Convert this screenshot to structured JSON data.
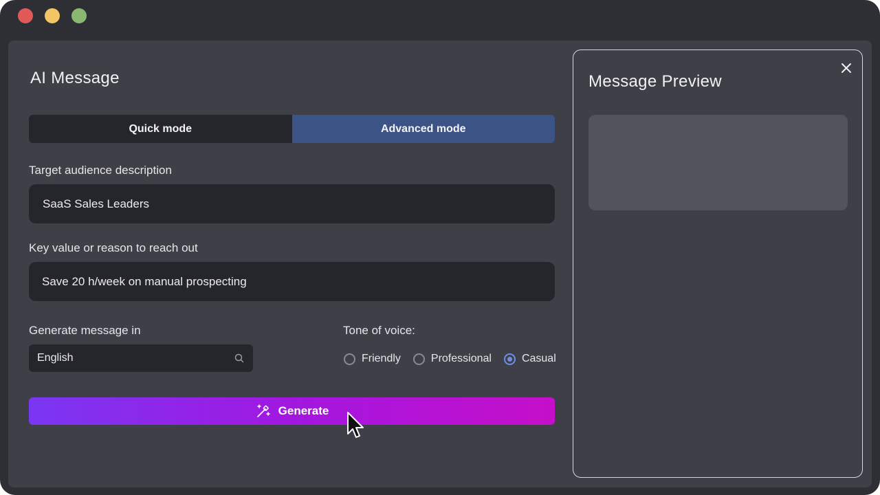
{
  "window": {
    "controls": [
      "close-dot",
      "minimize-dot",
      "zoom-dot"
    ]
  },
  "form": {
    "title": "AI Message",
    "modes": {
      "quick_label": "Quick mode",
      "advanced_label": "Advanced mode",
      "active": "advanced"
    },
    "audience": {
      "label": "Target audience description",
      "value": "SaaS Sales Leaders"
    },
    "value_prop": {
      "label": "Key value or reason to reach out",
      "value": "Save 20 h/week on manual prospecting"
    },
    "language": {
      "label": "Generate message in",
      "value": "English",
      "icon": "search-icon"
    },
    "tone": {
      "label": "Tone of voice:",
      "options": [
        "Friendly",
        "Professional",
        "Casual"
      ],
      "selected": "Casual"
    },
    "generate_label": "Generate",
    "generate_icon": "magic-wand-icon"
  },
  "preview": {
    "title": "Message Preview",
    "close_icon": "close-icon"
  },
  "colors": {
    "accent": "#6f8fe6",
    "advanced_tab": "#3c5386",
    "gradient_start": "#7a37f2",
    "gradient_end": "#c50fc9"
  }
}
